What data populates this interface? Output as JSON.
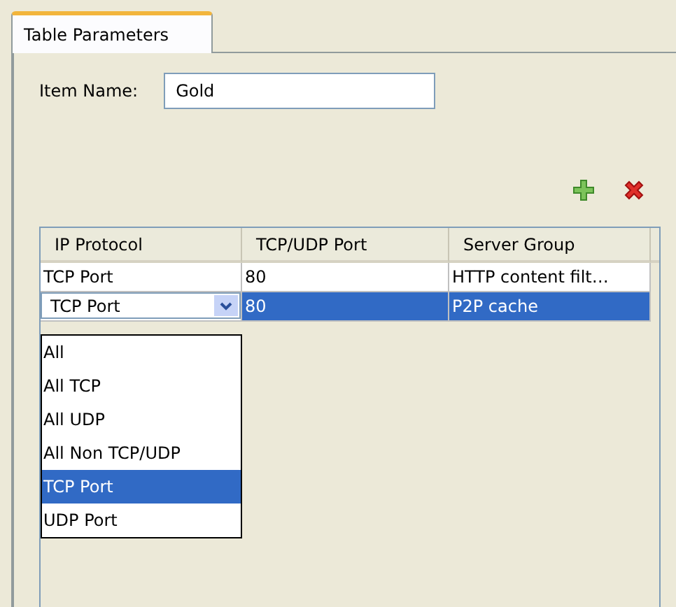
{
  "tabs": [
    {
      "label": "Table Parameters",
      "selected": true
    }
  ],
  "item_name": {
    "label": "Item Name:",
    "value": "Gold"
  },
  "toolbar": [
    {
      "kind": "add"
    },
    {
      "kind": "delete"
    }
  ],
  "table": {
    "columns": [
      "IP Protocol",
      "TCP/UDP Port",
      "Server Group"
    ],
    "rows": [
      {
        "selected": false,
        "editing": false,
        "cells": [
          "TCP Port",
          "80",
          "HTTP content filt…"
        ]
      },
      {
        "selected": true,
        "editing": true,
        "cells": [
          "TCP Port",
          "80",
          "P2P cache"
        ]
      }
    ]
  },
  "dropdown": {
    "options": [
      {
        "label": "All",
        "selected": false
      },
      {
        "label": "All TCP",
        "selected": false
      },
      {
        "label": "All UDP",
        "selected": false
      },
      {
        "label": "All Non TCP/UDP",
        "selected": false
      },
      {
        "label": "TCP Port",
        "selected": true
      },
      {
        "label": "UDP Port",
        "selected": false
      }
    ]
  }
}
